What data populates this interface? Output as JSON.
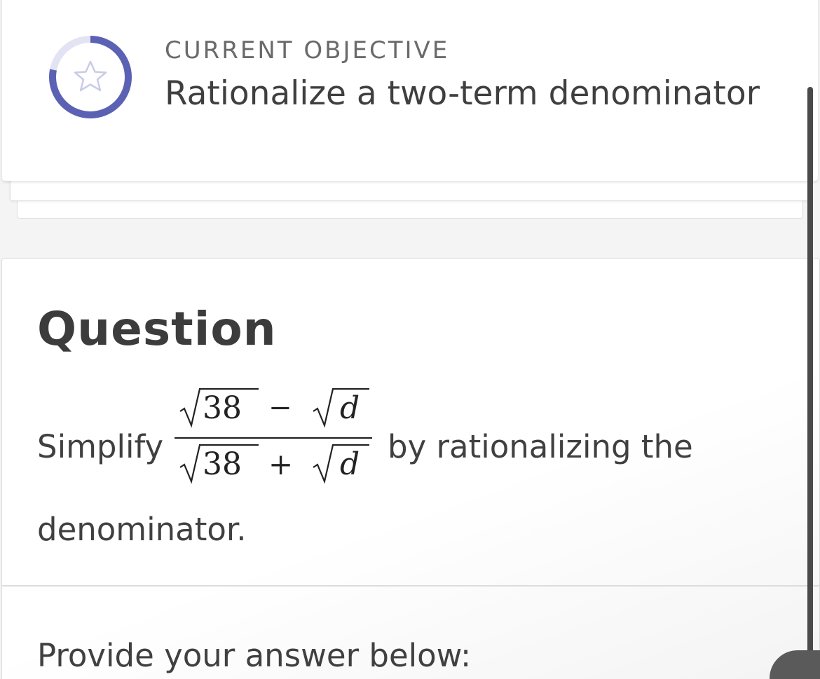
{
  "objective": {
    "eyebrow": "CURRENT OBJECTIVE",
    "title": "Rationalize a two-term denominator",
    "icon": "star-icon",
    "progress": 0.78,
    "ring_color": "#5b62b3",
    "ring_track_color": "#e3e4f3"
  },
  "question": {
    "heading": "Question",
    "prefix": "Simplify",
    "suffix": "by rationalizing the",
    "continuation": "denominator.",
    "fraction": {
      "numerator": {
        "radicand_1": "38",
        "operator": "−",
        "radicand_2": "d"
      },
      "denominator": {
        "radicand_1": "38",
        "operator": "+",
        "radicand_2": "d"
      }
    }
  },
  "answer": {
    "prompt": "Provide your answer below:"
  }
}
